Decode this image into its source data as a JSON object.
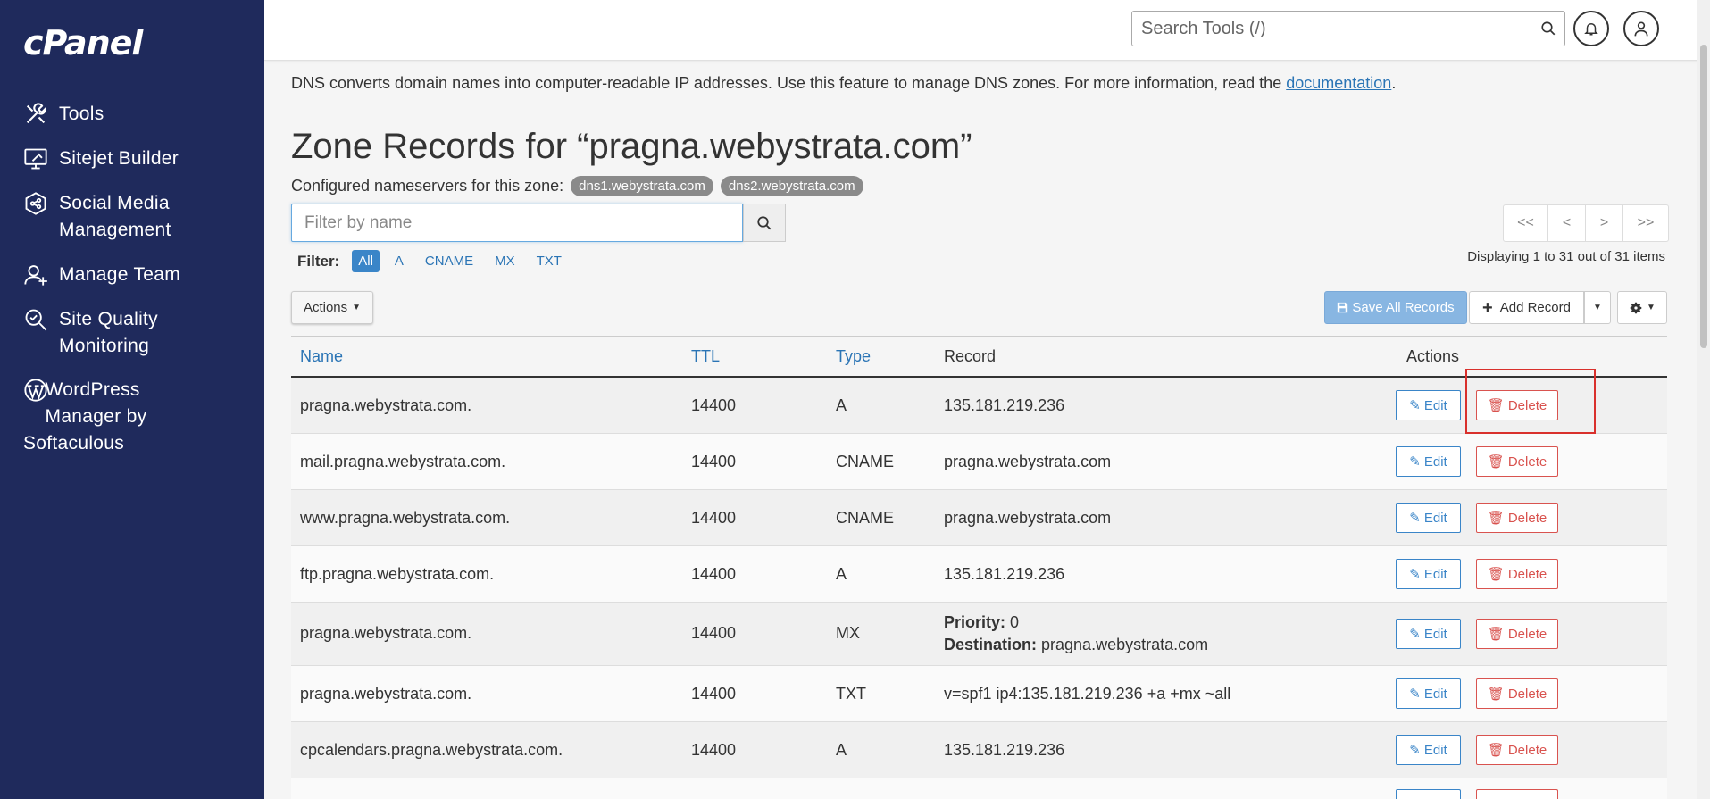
{
  "sidebar": {
    "logo": "cPanel",
    "items": [
      {
        "label": "Tools"
      },
      {
        "label": "Sitejet Builder"
      },
      {
        "label": "Social Media\nManagement"
      },
      {
        "label": "Manage Team"
      },
      {
        "label": "Site Quality\nMonitoring"
      }
    ],
    "wordpress_label": "    WordPress\n    Manager by\nSoftaculous"
  },
  "topbar": {
    "search_placeholder": "Search Tools (/)"
  },
  "intro": {
    "text": "DNS converts domain names into computer-readable IP addresses. Use this feature to manage DNS zones. For more information, read the ",
    "link": "documentation",
    "end": "."
  },
  "page_title": "Zone Records for “pragna.webystrata.com”",
  "nameservers": {
    "label": "Configured nameservers for this zone:",
    "ns1": "dns1.webystrata.com",
    "ns2": "dns2.webystrata.com"
  },
  "filter": {
    "placeholder": "Filter by name",
    "label": "Filter:",
    "options": [
      "All",
      "A",
      "CNAME",
      "MX",
      "TXT"
    ]
  },
  "pager": {
    "first": "<<",
    "prev": "<",
    "next": ">",
    "last": ">>",
    "displaying": "Displaying 1 to 31 out of 31 items"
  },
  "toolbar": {
    "actions": "Actions",
    "save_all": "Save All Records",
    "add_record": "Add Record"
  },
  "table": {
    "headers": {
      "name": "Name",
      "ttl": "TTL",
      "type": "Type",
      "record": "Record",
      "actions": "Actions"
    },
    "edit_label": "Edit",
    "delete_label": "Delete",
    "rows": [
      {
        "name": "pragna.webystrata.com.",
        "ttl": "14400",
        "type": "A",
        "record": "135.181.219.236"
      },
      {
        "name": "mail.pragna.webystrata.com.",
        "ttl": "14400",
        "type": "CNAME",
        "record": "pragna.webystrata.com"
      },
      {
        "name": "www.pragna.webystrata.com.",
        "ttl": "14400",
        "type": "CNAME",
        "record": "pragna.webystrata.com"
      },
      {
        "name": "ftp.pragna.webystrata.com.",
        "ttl": "14400",
        "type": "A",
        "record": "135.181.219.236"
      },
      {
        "name": "pragna.webystrata.com.",
        "ttl": "14400",
        "type": "MX",
        "priority_label": "Priority:",
        "priority": " 0",
        "dest_label": "Destination:",
        "dest": " pragna.webystrata.com"
      },
      {
        "name": "pragna.webystrata.com.",
        "ttl": "14400",
        "type": "TXT",
        "record": "v=spf1 ip4:135.181.219.236 +a +mx ~all"
      },
      {
        "name": "cpcalendars.pragna.webystrata.com.",
        "ttl": "14400",
        "type": "A",
        "record": "135.181.219.236"
      }
    ]
  },
  "colors": {
    "sidebar": "#1f2a5c",
    "link": "#2a74b5",
    "danger": "#d9534f",
    "primary": "#3a85c8"
  }
}
